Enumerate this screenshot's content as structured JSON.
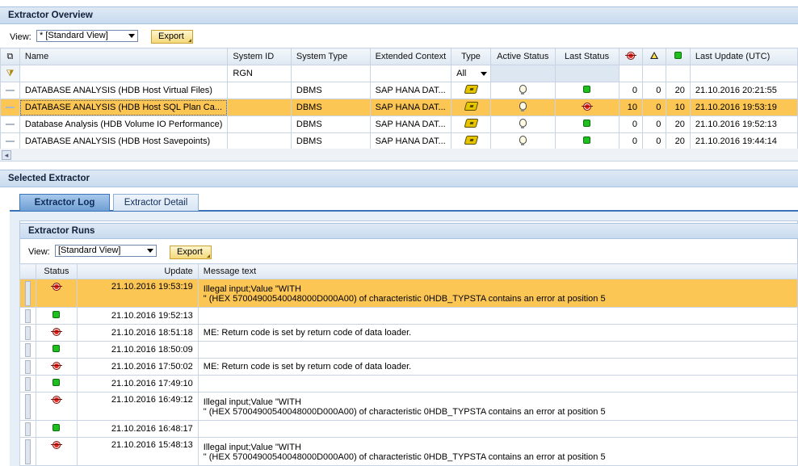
{
  "overview": {
    "title": "Extractor Overview",
    "view_label": "View:",
    "view_value": "* [Standard View]",
    "export_label": "Export",
    "columns": [
      "Name",
      "System ID",
      "System Type",
      "Extended Context",
      "Type",
      "Active Status",
      "Last Status",
      "Last Update (UTC)"
    ],
    "filter": {
      "system_id": "RGN",
      "type": "All"
    },
    "rows": [
      {
        "name": "DATABASE ANALYSIS (HDB Host Virtual Files)",
        "system_id": "",
        "system_type": "DBMS",
        "ext_context": "SAP HANA DAT...",
        "last_status": "green",
        "red": "0",
        "yellow": "0",
        "green": "20",
        "last_update": "21.10.2016 20:21:55"
      },
      {
        "name": "DATABASE ANALYSIS (HDB Host SQL Plan Ca...",
        "system_id": "",
        "system_type": "DBMS",
        "ext_context": "SAP HANA DAT...",
        "last_status": "red",
        "red": "10",
        "yellow": "0",
        "green": "10",
        "last_update": "21.10.2016 19:53:19"
      },
      {
        "name": "Database Analysis (HDB Volume IO Performance)",
        "system_id": "",
        "system_type": "DBMS",
        "ext_context": "SAP HANA DAT...",
        "last_status": "green",
        "red": "0",
        "yellow": "0",
        "green": "20",
        "last_update": "21.10.2016 19:52:13"
      },
      {
        "name": "DATABASE ANALYSIS (HDB Host Savepoints)",
        "system_id": "",
        "system_type": "DBMS",
        "ext_context": "SAP HANA DAT...",
        "last_status": "green",
        "red": "0",
        "yellow": "0",
        "green": "20",
        "last_update": "21.10.2016 19:44:14"
      }
    ]
  },
  "selected": {
    "title": "Selected Extractor",
    "tabs": [
      "Extractor Log",
      "Extractor Detail"
    ]
  },
  "runs": {
    "title": "Extractor Runs",
    "view_label": "View:",
    "view_value": "[Standard View]",
    "export_label": "Export",
    "columns": [
      "Status",
      "Update",
      "Message text"
    ],
    "rows": [
      {
        "status": "red",
        "update": "21.10.2016 19:53:19",
        "msg1": "Illegal input;Value \"WITH",
        "msg2": "\" (HEX 57004900540048000D000A00) of characteristic 0HDB_TYPSTA contains an error at position 5"
      },
      {
        "status": "green",
        "update": "21.10.2016 19:52:13",
        "msg1": "",
        "msg2": ""
      },
      {
        "status": "red",
        "update": "21.10.2016 18:51:18",
        "msg1": "ME: Return code is set by return code of data loader.",
        "msg2": ""
      },
      {
        "status": "green",
        "update": "21.10.2016 18:50:09",
        "msg1": "",
        "msg2": ""
      },
      {
        "status": "red",
        "update": "21.10.2016 17:50:02",
        "msg1": "ME: Return code is set by return code of data loader.",
        "msg2": ""
      },
      {
        "status": "green",
        "update": "21.10.2016 17:49:10",
        "msg1": "",
        "msg2": ""
      },
      {
        "status": "red",
        "update": "21.10.2016 16:49:12",
        "msg1": "Illegal input;Value \"WITH",
        "msg2": "\" (HEX 57004900540048000D000A00) of characteristic 0HDB_TYPSTA contains an error at position 5"
      },
      {
        "status": "green",
        "update": "21.10.2016 16:48:17",
        "msg1": "",
        "msg2": ""
      },
      {
        "status": "red",
        "update": "21.10.2016 15:48:13",
        "msg1": "Illegal input;Value \"WITH",
        "msg2": "\" (HEX 57004900540048000D000A00) of characteristic 0HDB_TYPSTA contains an error at position 5"
      }
    ]
  },
  "colors": {
    "highlight": "#fcc655",
    "header": "#c9dbef",
    "status_red": "#e8241a",
    "status_green": "#1fbf1f"
  }
}
